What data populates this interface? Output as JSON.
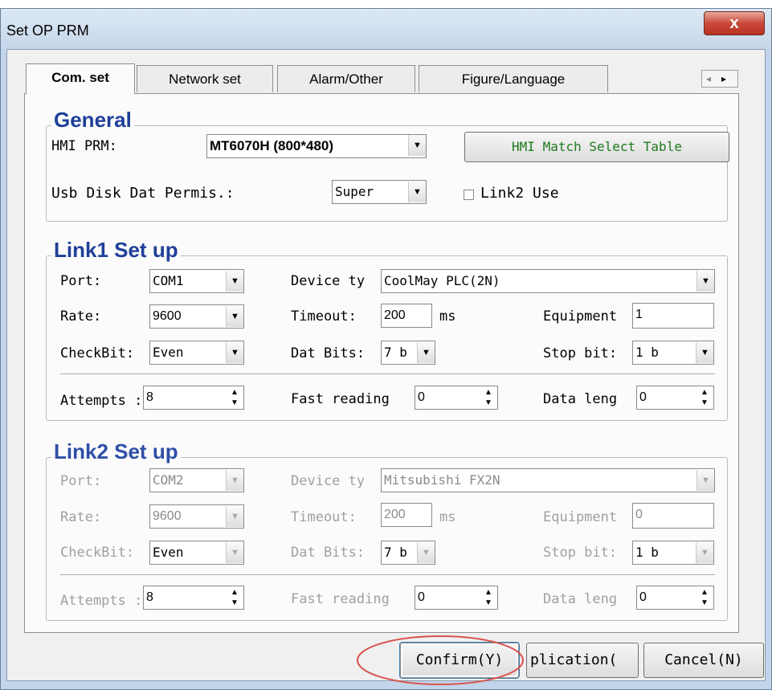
{
  "window": {
    "title": "Set OP PRM",
    "close_glyph": "x"
  },
  "tabs": [
    "Com. set",
    "Network set",
    "Alarm/Other",
    "Figure/Language"
  ],
  "tab_scroll": {
    "left": "◂",
    "right": "▸"
  },
  "general": {
    "title": "General",
    "hmi_prm_label": "HMI PRM:",
    "hmi_prm_value": "MT6070H (800*480)",
    "match_button": "HMI Match Select Table",
    "usb_label": "Usb Disk Dat Permis.:",
    "usb_value": "Super",
    "link2_use_label": "Link2 Use"
  },
  "link1": {
    "title": "Link1 Set up",
    "port_label": "Port:",
    "port_value": "COM1",
    "device_label": "Device ty",
    "device_value": "CoolMay PLC(2N)",
    "rate_label": "Rate:",
    "rate_value": "9600",
    "timeout_label": "Timeout:",
    "timeout_value": "200",
    "timeout_unit": "ms",
    "equipment_label": "Equipment",
    "equipment_value": "1",
    "checkbit_label": "CheckBit:",
    "checkbit_value": "Even",
    "databits_label": "Dat Bits:",
    "databits_value": "7 b",
    "stopbit_label": "Stop bit:",
    "stopbit_value": "1 b",
    "attempts_label": "Attempts :",
    "attempts_value": "8",
    "fast_label": "Fast reading",
    "fast_value": "0",
    "datalen_label": "Data leng",
    "datalen_value": "0"
  },
  "link2": {
    "title": "Link2 Set up",
    "port_label": "Port:",
    "port_value": "COM2",
    "device_label": "Device ty",
    "device_value": "Mitsubishi FX2N",
    "rate_label": "Rate:",
    "rate_value": "9600",
    "timeout_label": "Timeout:",
    "timeout_value": "200",
    "timeout_unit": "ms",
    "equipment_label": "Equipment",
    "equipment_value": "0",
    "checkbit_label": "CheckBit:",
    "checkbit_value": "Even",
    "databits_label": "Dat Bits:",
    "databits_value": "7 b",
    "stopbit_label": "Stop bit:",
    "stopbit_value": "1 b",
    "attempts_label": "Attempts :",
    "attempts_value": "8",
    "fast_label": "Fast reading",
    "fast_value": "0",
    "datalen_label": "Data leng",
    "datalen_value": "0"
  },
  "buttons": {
    "confirm": "Confirm(Y)",
    "application": "plication(",
    "cancel": "Cancel(N)"
  },
  "icons": {
    "dropdown": "▼",
    "spin_up": "▲",
    "spin_down": "▼"
  },
  "colors": {
    "group_title": "#1f3f9a",
    "match_button_text": "#1f7a1f",
    "highlight_circle": "#d9534f"
  }
}
